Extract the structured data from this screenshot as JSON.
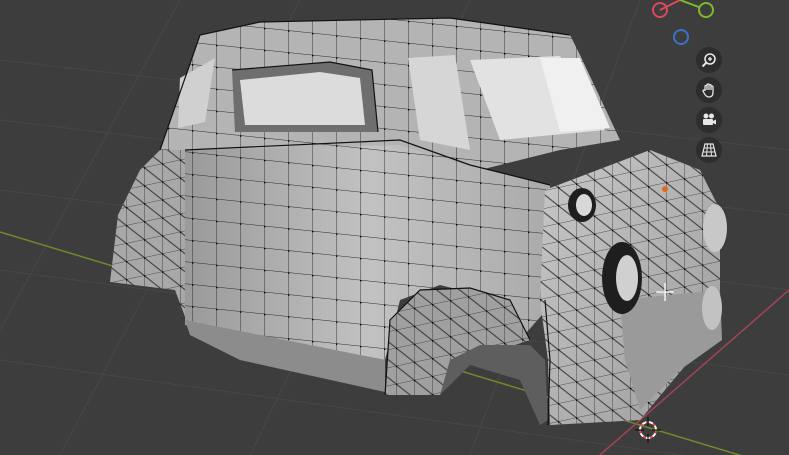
{
  "app": "3D Viewport",
  "colors": {
    "background": "#3d3d3d",
    "grid": "#4a4a4a",
    "x_axis": "#b34a5a",
    "y_axis": "#7a9a2a",
    "mesh_fill": "#b8b8b8",
    "mesh_dark": "#7e7e7e",
    "wire": "#2a2a2a",
    "vertex": "#000000",
    "nav_button_bg": "#2a2a2a",
    "gizmo_x": "#e0465e",
    "gizmo_y": "#7fba2a",
    "gizmo_z": "#3b73c8"
  },
  "gizmo": {
    "axes": [
      "X",
      "Y",
      "Z"
    ]
  },
  "navigation": {
    "buttons": [
      {
        "name": "zoom",
        "icon": "zoom-icon"
      },
      {
        "name": "pan",
        "icon": "hand-icon"
      },
      {
        "name": "camera-view",
        "icon": "camera-icon"
      },
      {
        "name": "perspective-toggle",
        "icon": "grid-icon"
      }
    ]
  },
  "scene": {
    "object": "car-body-mesh",
    "mode": "edit",
    "cursor_3d": "3d-cursor-icon",
    "origin": "origin-dot"
  }
}
